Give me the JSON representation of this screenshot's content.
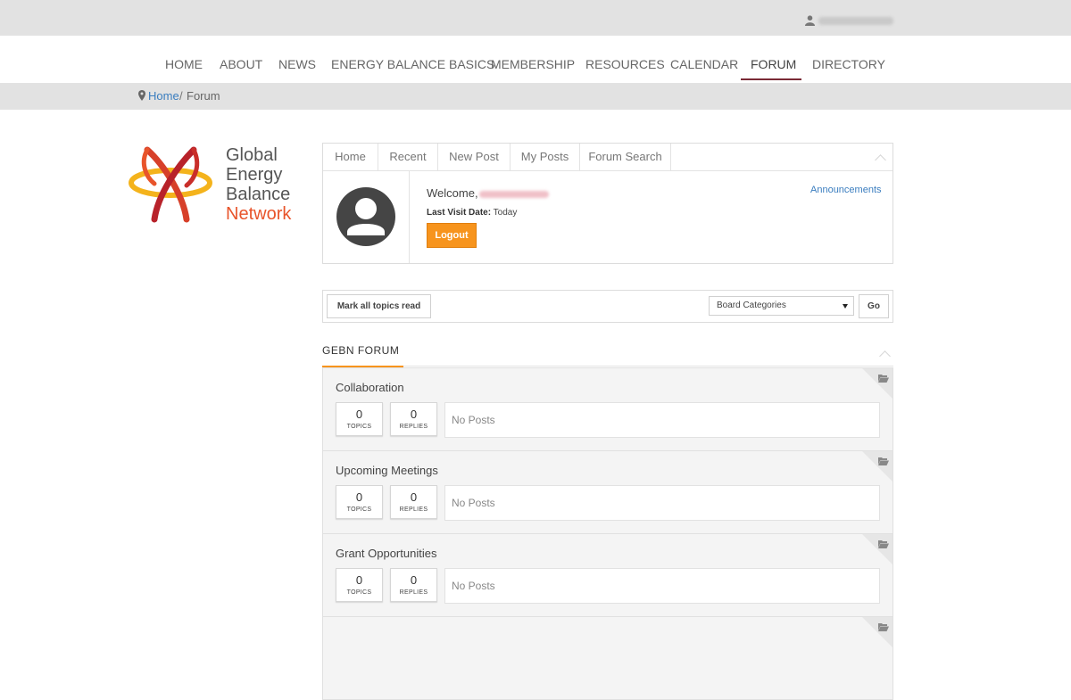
{
  "top_bar": {
    "user_name": ""
  },
  "nav": {
    "items": [
      "HOME",
      "ABOUT",
      "NEWS",
      "ENERGY BALANCE BASICS",
      "MEMBERSHIP",
      "RESOURCES",
      "CALENDAR",
      "FORUM",
      "DIRECTORY"
    ],
    "active": "FORUM",
    "active_color": "#7a2a36"
  },
  "breadcrumb": {
    "home": "Home",
    "separator": "/",
    "current": "Forum"
  },
  "logo": {
    "lines": [
      "Global",
      "Energy",
      "Balance",
      "Network"
    ],
    "accent_color": "#e8542b"
  },
  "forum_tabs": [
    "Home",
    "Recent",
    "New Post",
    "My Posts",
    "Forum Search"
  ],
  "user_panel": {
    "welcome": "Welcome,",
    "last_visit_label": "Last Visit Date:",
    "last_visit_value": "Today",
    "logout_label": "Logout",
    "announcements_link": "Announcements",
    "button_color": "#f7941d"
  },
  "toolbar": {
    "mark_read_label": "Mark all topics read",
    "category_select": "Board Categories",
    "go_label": "Go"
  },
  "section": {
    "title": "GEBN FORUM"
  },
  "boards": [
    {
      "name": "Collaboration",
      "topics": "0",
      "topics_label": "TOPICS",
      "replies": "0",
      "replies_label": "REPLIES",
      "last_post": "No Posts"
    },
    {
      "name": "Upcoming Meetings",
      "topics": "0",
      "topics_label": "TOPICS",
      "replies": "0",
      "replies_label": "REPLIES",
      "last_post": "No Posts"
    },
    {
      "name": "Grant Opportunities",
      "topics": "0",
      "topics_label": "TOPICS",
      "replies": "0",
      "replies_label": "REPLIES",
      "last_post": "No Posts"
    }
  ]
}
